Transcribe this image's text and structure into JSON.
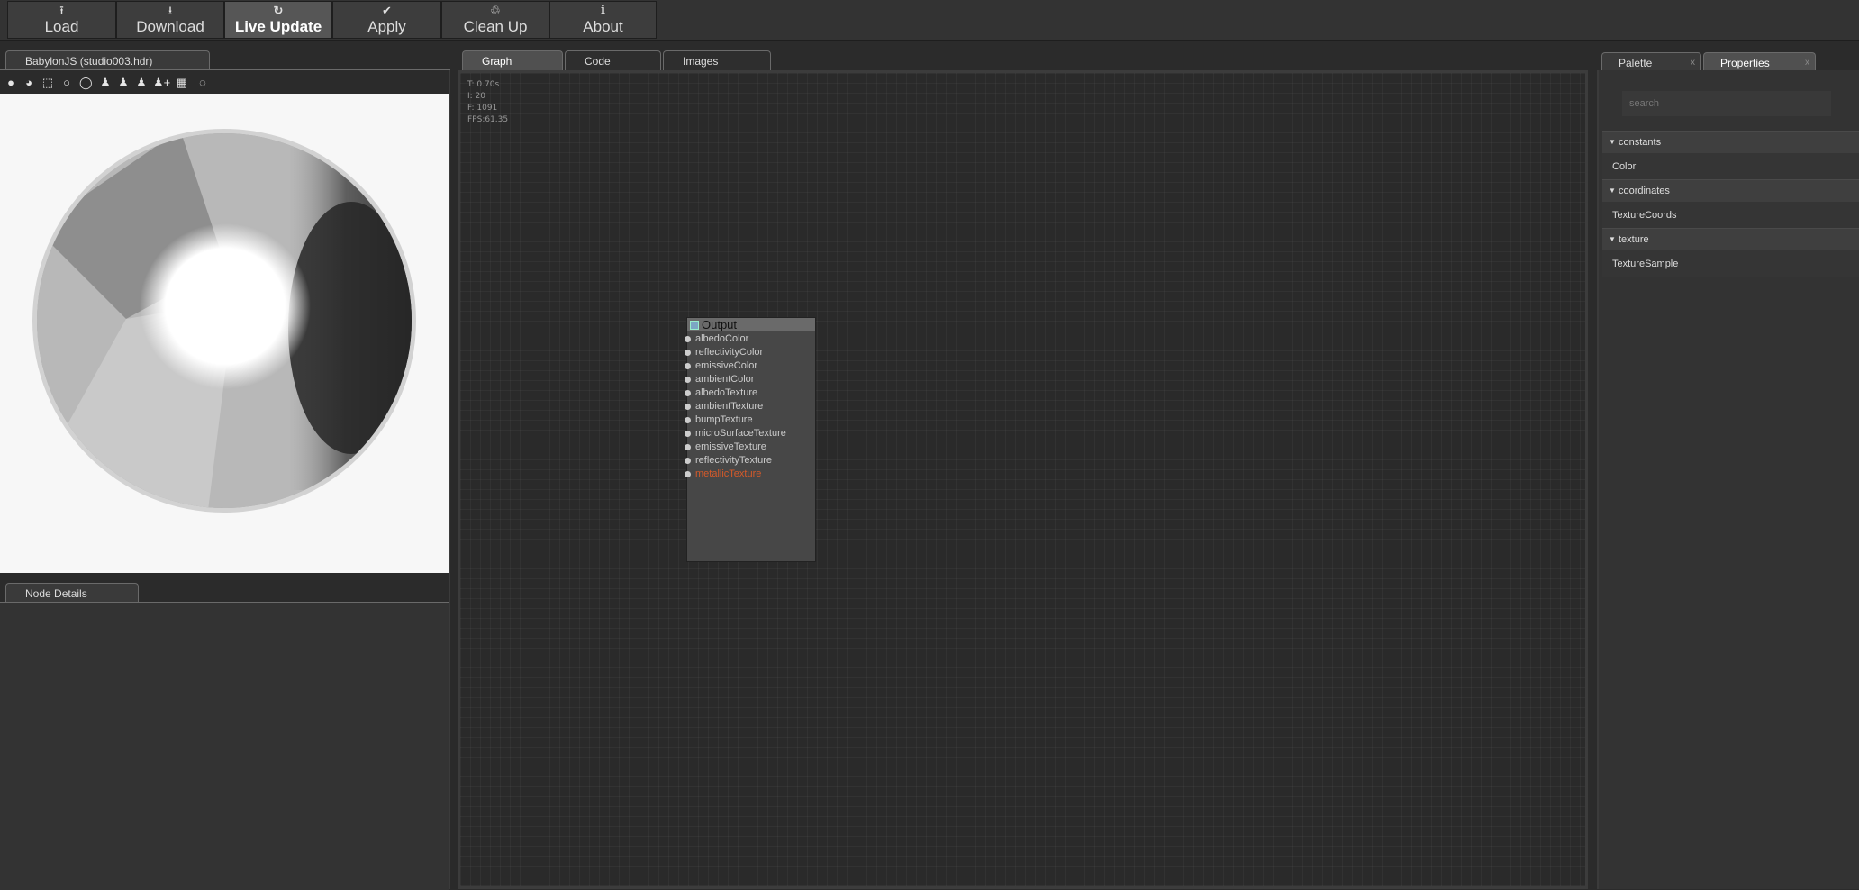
{
  "toolbar": {
    "buttons": [
      {
        "label": "Load",
        "icon": "upload-icon"
      },
      {
        "label": "Download",
        "icon": "download-icon"
      },
      {
        "label": "Live Update",
        "icon": "refresh-icon"
      },
      {
        "label": "Apply",
        "icon": "check-circle-icon"
      },
      {
        "label": "Clean Up",
        "icon": "trash-icon"
      },
      {
        "label": "About",
        "icon": "info-icon"
      }
    ]
  },
  "preview": {
    "tab_label": "BabylonJS (studio003.hdr)",
    "toolbar_icons": [
      "sphere-icon",
      "globe-icon",
      "cube-icon",
      "circle-icon",
      "circle-outline-icon",
      "user-icon",
      "user-icon",
      "user-icon",
      "user-add-icon",
      "grid-icon",
      "spinner-icon"
    ]
  },
  "node_details": {
    "tab_label": "Node Details"
  },
  "graph": {
    "tabs": [
      "Graph",
      "Code",
      "Images"
    ],
    "stats": {
      "time": "T: 0.70s",
      "iterations": "I: 20",
      "frames": "F: 1091",
      "fps": "FPS:61.35"
    },
    "output_node": {
      "title": "Output",
      "ports": [
        "albedoColor",
        "reflectivityColor",
        "emissiveColor",
        "ambientColor",
        "albedoTexture",
        "ambientTexture",
        "bumpTexture",
        "microSurfaceTexture",
        "emissiveTexture",
        "reflectivityTexture",
        "metallicTexture"
      ],
      "error_port": "metallicTexture"
    }
  },
  "right_panel": {
    "tabs": [
      {
        "label": "Palette",
        "close": "x"
      },
      {
        "label": "Properties",
        "close": "x"
      }
    ],
    "search_placeholder": "search",
    "categories": [
      {
        "name": "constants",
        "items": [
          "Color"
        ]
      },
      {
        "name": "coordinates",
        "items": [
          "TextureCoords"
        ]
      },
      {
        "name": "texture",
        "items": [
          "TextureSample"
        ]
      }
    ]
  },
  "colors": {
    "background": "#2b2b2b",
    "toolbar": "#333333",
    "active_button": "#565656",
    "node_error_label": "#d45a2a",
    "node_header": "#6a6a6a"
  }
}
